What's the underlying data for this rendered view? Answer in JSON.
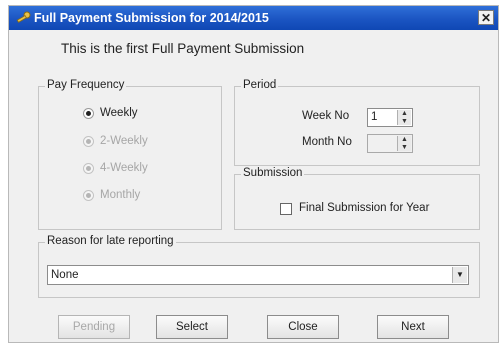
{
  "window": {
    "title": "Full Payment Submission for 2014/2015",
    "close_glyph": "✕"
  },
  "header_message": "This is the first Full Payment Submission",
  "pay_frequency": {
    "label": "Pay Frequency",
    "options": [
      {
        "label": "Weekly",
        "selected": true,
        "enabled": true
      },
      {
        "label": "2-Weekly",
        "selected": false,
        "enabled": false
      },
      {
        "label": "4-Weekly",
        "selected": false,
        "enabled": false
      },
      {
        "label": "Monthly",
        "selected": false,
        "enabled": false
      }
    ]
  },
  "period": {
    "label": "Period",
    "week_no_label": "Week No",
    "week_no_value": "1",
    "month_no_label": "Month No",
    "month_no_value": ""
  },
  "submission": {
    "label": "Submission",
    "final_checkbox_label": "Final Submission for Year",
    "final_checked": false
  },
  "late_reporting": {
    "label": "Reason for late reporting",
    "selected_value": "None"
  },
  "buttons": {
    "pending": "Pending",
    "select": "Select",
    "close": "Close",
    "next": "Next"
  },
  "icons": {
    "app": "key-icon",
    "spin_up": "▲",
    "spin_down": "▼",
    "dropdown": "▼"
  }
}
